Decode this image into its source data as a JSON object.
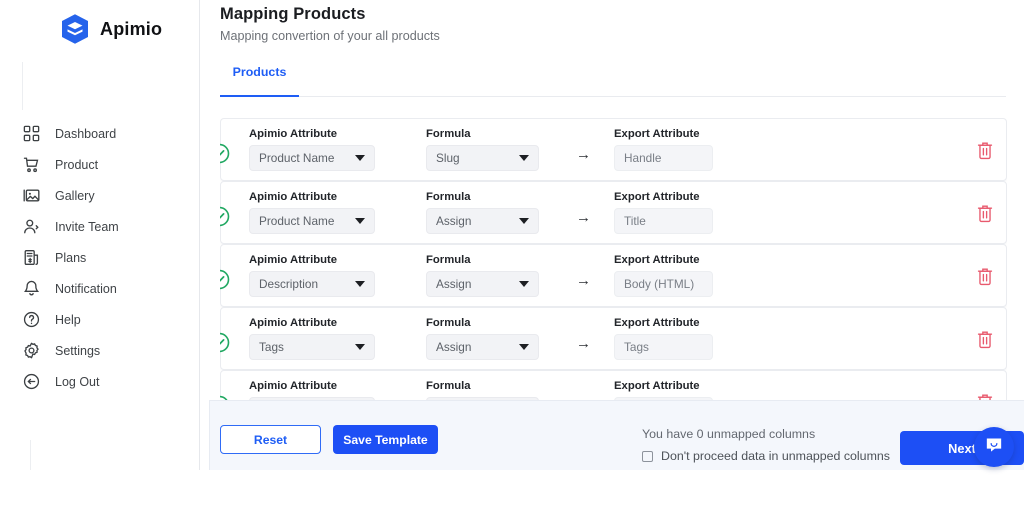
{
  "brand": {
    "name": "Apimio",
    "logo_icon": "apimio-cube-logo",
    "accent": "#1d4ff5"
  },
  "sidebar": {
    "items": [
      {
        "label": "Dashboard",
        "icon": "grid-dashboard-icon"
      },
      {
        "label": "Product",
        "icon": "shopping-cart-icon"
      },
      {
        "label": "Gallery",
        "icon": "image-gallery-icon"
      },
      {
        "label": "Invite Team",
        "icon": "user-add-icon"
      },
      {
        "label": "Plans",
        "icon": "invoice-dollar-icon"
      },
      {
        "label": "Notification",
        "icon": "bell-icon"
      },
      {
        "label": "Help",
        "icon": "question-circle-icon"
      },
      {
        "label": "Settings",
        "icon": "gear-icon"
      },
      {
        "label": "Log Out",
        "icon": "logout-arrow-icon"
      }
    ]
  },
  "header": {
    "title": "Mapping Products",
    "subtitle": "Mapping convertion of your all products"
  },
  "tabs": [
    {
      "label": "Products",
      "active": true
    }
  ],
  "row_labels": {
    "source": "Apimio Attribute",
    "formula": "Formula",
    "target": "Export Attribute",
    "arrow_icon": "arrow-right-icon",
    "status_icon": "check-circle-icon",
    "delete_icon": "trash-icon"
  },
  "mapping_rows": [
    {
      "source": "Product Name",
      "formula": "Slug",
      "target": "Handle",
      "status": "mapped"
    },
    {
      "source": "Product Name",
      "formula": "Assign",
      "target": "Title",
      "status": "mapped"
    },
    {
      "source": "Description",
      "formula": "Assign",
      "target": "Body (HTML)",
      "status": "mapped"
    },
    {
      "source": "Tags",
      "formula": "Assign",
      "target": "Tags",
      "status": "mapped"
    },
    {
      "source": "",
      "formula": "",
      "target": "",
      "status": "mapped"
    }
  ],
  "footer": {
    "reset_label": "Reset",
    "save_label": "Save Template",
    "unmapped_text": "You have 0 unmapped columns",
    "checkbox_label": "Don't proceed data in unmapped columns",
    "checkbox_checked": false,
    "next_label": "Next",
    "chat_icon": "chat-bubble-icon"
  }
}
